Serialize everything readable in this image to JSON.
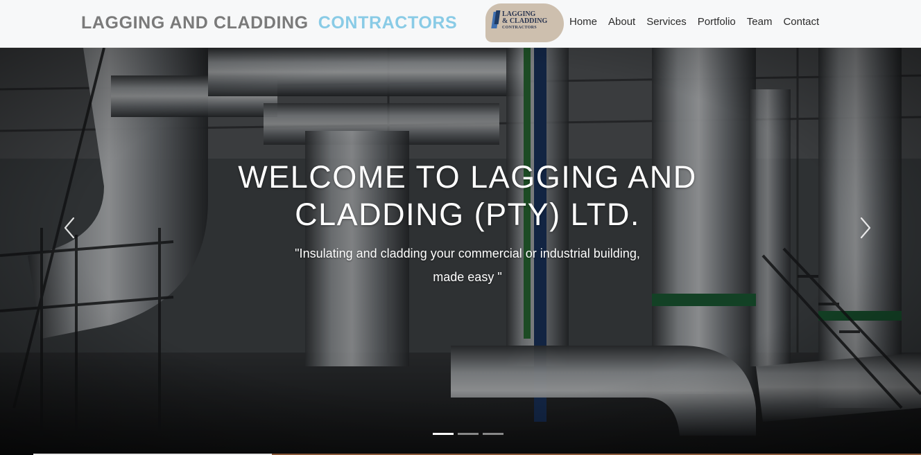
{
  "header": {
    "brand_part1": "LAGGING AND CLADDING",
    "brand_part2": "CONTRACTORS",
    "logo_text": {
      "line1": "LAGGING",
      "line2": "& CLADDING",
      "line3": "CONTRACTORS"
    },
    "nav": [
      "Home",
      "About",
      "Services",
      "Portfolio",
      "Team",
      "Contact"
    ]
  },
  "hero": {
    "title": "WELCOME TO LAGGING AND CLADDING (PTY) LTD.",
    "subtitle": "\"Insulating and cladding your commercial or industrial building, made easy \"",
    "slides_total": 3,
    "active_slide": 1
  },
  "colors": {
    "brand_gray": "#7a7a7a",
    "brand_blue": "#89cbe6",
    "header_bg": "#f7f8f9",
    "nav_text": "#2b2b2b"
  },
  "icons": {
    "prev": "chevron-left-icon",
    "next": "chevron-right-icon"
  }
}
